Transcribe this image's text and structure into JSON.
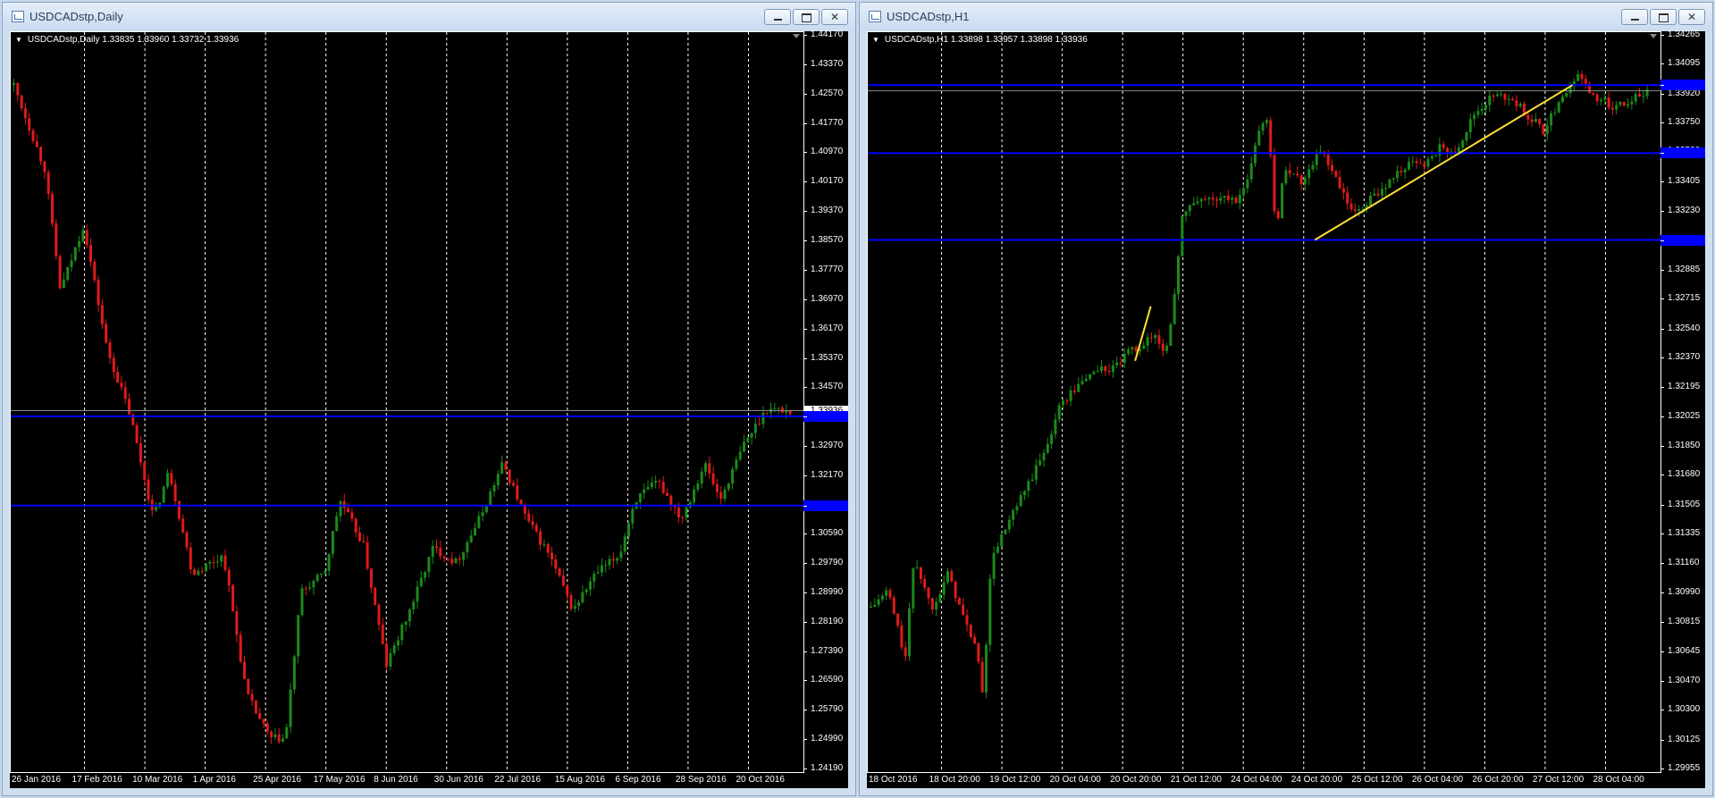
{
  "colors": {
    "bull": "#1a8a1a",
    "bear": "#e01a1a",
    "hline": "#0000ff",
    "trend": "#ffe033",
    "grid": "#ffffff"
  },
  "windows": [
    {
      "title": "USDCADstp,Daily",
      "header_text": "USDCADstp,Daily  1.33835 1.33960 1.33732 1.33936",
      "price_ticks": [
        "1.44170",
        "1.43370",
        "1.42570",
        "1.41770",
        "1.40970",
        "1.40170",
        "1.39370",
        "1.38570",
        "1.37770",
        "1.36970",
        "1.36170",
        "1.35370",
        "1.34570",
        "1.33936",
        "1.32970",
        "1.32170",
        "1.31380",
        "1.30590",
        "1.29790",
        "1.28990",
        "1.28190",
        "1.27390",
        "1.26590",
        "1.25790",
        "1.24990",
        "1.24190"
      ],
      "time_ticks": [
        "26 Jan 2016",
        "17 Feb 2016",
        "10 Mar 2016",
        "1 Apr 2016",
        "25 Apr 2016",
        "17 May 2016",
        "8 Jun 2016",
        "30 Jun 2016",
        "22 Jul 2016",
        "15 Aug 2016",
        "6 Sep 2016",
        "28 Sep 2016",
        "20 Oct 2016"
      ],
      "price_range": [
        1.2419,
        1.4417
      ],
      "hlines": [
        1.3378,
        1.3135
      ],
      "current_price": 1.33936,
      "trendlines": [],
      "candle_path": [
        [
          0,
          1.428
        ],
        [
          0.04,
          1.405
        ],
        [
          0.06,
          1.372
        ],
        [
          0.09,
          1.39
        ],
        [
          0.12,
          1.356
        ],
        [
          0.15,
          1.338
        ],
        [
          0.18,
          1.31
        ],
        [
          0.2,
          1.323
        ],
        [
          0.23,
          1.295
        ],
        [
          0.27,
          1.3
        ],
        [
          0.3,
          1.262
        ],
        [
          0.33,
          1.25
        ],
        [
          0.35,
          1.25
        ],
        [
          0.37,
          1.29
        ],
        [
          0.4,
          1.295
        ],
        [
          0.42,
          1.315
        ],
        [
          0.45,
          1.303
        ],
        [
          0.48,
          1.27
        ],
        [
          0.51,
          1.285
        ],
        [
          0.54,
          1.302
        ],
        [
          0.57,
          1.298
        ],
        [
          0.6,
          1.31
        ],
        [
          0.63,
          1.325
        ],
        [
          0.66,
          1.31
        ],
        [
          0.69,
          1.3
        ],
        [
          0.72,
          1.285
        ],
        [
          0.75,
          1.295
        ],
        [
          0.78,
          1.3
        ],
        [
          0.8,
          1.315
        ],
        [
          0.83,
          1.32
        ],
        [
          0.86,
          1.31
        ],
        [
          0.89,
          1.325
        ],
        [
          0.91,
          1.315
        ],
        [
          0.94,
          1.33
        ],
        [
          0.97,
          1.34
        ],
        [
          1.0,
          1.3392
        ]
      ]
    },
    {
      "title": "USDCADstp,H1",
      "header_text": "USDCADstp,H1  1.33898 1.33957 1.33898 1.33936",
      "price_ticks": [
        "1.34265",
        "1.34095",
        "1.33920",
        "1.33750",
        "1.33580",
        "1.33405",
        "1.33230",
        "1.33060",
        "1.32885",
        "1.32715",
        "1.32540",
        "1.32370",
        "1.32195",
        "1.32025",
        "1.31850",
        "1.31680",
        "1.31505",
        "1.31335",
        "1.31160",
        "1.30990",
        "1.30815",
        "1.30645",
        "1.30470",
        "1.30300",
        "1.30125",
        "1.29955"
      ],
      "time_ticks": [
        "18 Oct 2016",
        "18 Oct 20:00",
        "19 Oct 12:00",
        "20 Oct 04:00",
        "20 Oct 20:00",
        "21 Oct 12:00",
        "24 Oct 04:00",
        "24 Oct 20:00",
        "25 Oct 12:00",
        "26 Oct 04:00",
        "26 Oct 20:00",
        "27 Oct 12:00",
        "28 Oct 04:00"
      ],
      "price_range": [
        1.29955,
        1.34265
      ],
      "hlines": [
        1.3397,
        1.3357,
        1.3306
      ],
      "current_price": 1.33936,
      "trendlines": [
        {
          "x1": 0.34,
          "y1": 1.3235,
          "x2": 0.36,
          "y2": 1.3267
        },
        {
          "x1": 0.57,
          "y1": 1.3306,
          "x2": 0.9,
          "y2": 1.3397
        }
      ],
      "candle_path": [
        [
          0,
          1.309
        ],
        [
          0.02,
          1.31
        ],
        [
          0.04,
          1.306
        ],
        [
          0.05,
          1.312
        ],
        [
          0.07,
          1.309
        ],
        [
          0.09,
          1.311
        ],
        [
          0.11,
          1.308
        ],
        [
          0.12,
          1.307
        ],
        [
          0.13,
          1.304
        ],
        [
          0.14,
          1.312
        ],
        [
          0.16,
          1.314
        ],
        [
          0.18,
          1.316
        ],
        [
          0.2,
          1.318
        ],
        [
          0.22,
          1.321
        ],
        [
          0.24,
          1.322
        ],
        [
          0.26,
          1.323
        ],
        [
          0.28,
          1.323
        ],
        [
          0.3,
          1.324
        ],
        [
          0.33,
          1.325
        ],
        [
          0.34,
          1.324
        ],
        [
          0.35,
          1.326
        ],
        [
          0.36,
          1.332
        ],
        [
          0.38,
          1.333
        ],
        [
          0.4,
          1.333
        ],
        [
          0.43,
          1.333
        ],
        [
          0.45,
          1.337
        ],
        [
          0.46,
          1.338
        ],
        [
          0.47,
          1.331
        ],
        [
          0.48,
          1.335
        ],
        [
          0.5,
          1.334
        ],
        [
          0.52,
          1.336
        ],
        [
          0.54,
          1.334
        ],
        [
          0.56,
          1.332
        ],
        [
          0.58,
          1.333
        ],
        [
          0.6,
          1.334
        ],
        [
          0.62,
          1.335
        ],
        [
          0.64,
          1.335
        ],
        [
          0.66,
          1.336
        ],
        [
          0.68,
          1.336
        ],
        [
          0.7,
          1.338
        ],
        [
          0.72,
          1.339
        ],
        [
          0.74,
          1.339
        ],
        [
          0.76,
          1.338
        ],
        [
          0.78,
          1.337
        ],
        [
          0.8,
          1.339
        ],
        [
          0.82,
          1.3402
        ],
        [
          0.84,
          1.339
        ],
        [
          0.86,
          1.3385
        ],
        [
          0.88,
          1.3388
        ],
        [
          0.9,
          1.3394
        ]
      ]
    }
  ]
}
